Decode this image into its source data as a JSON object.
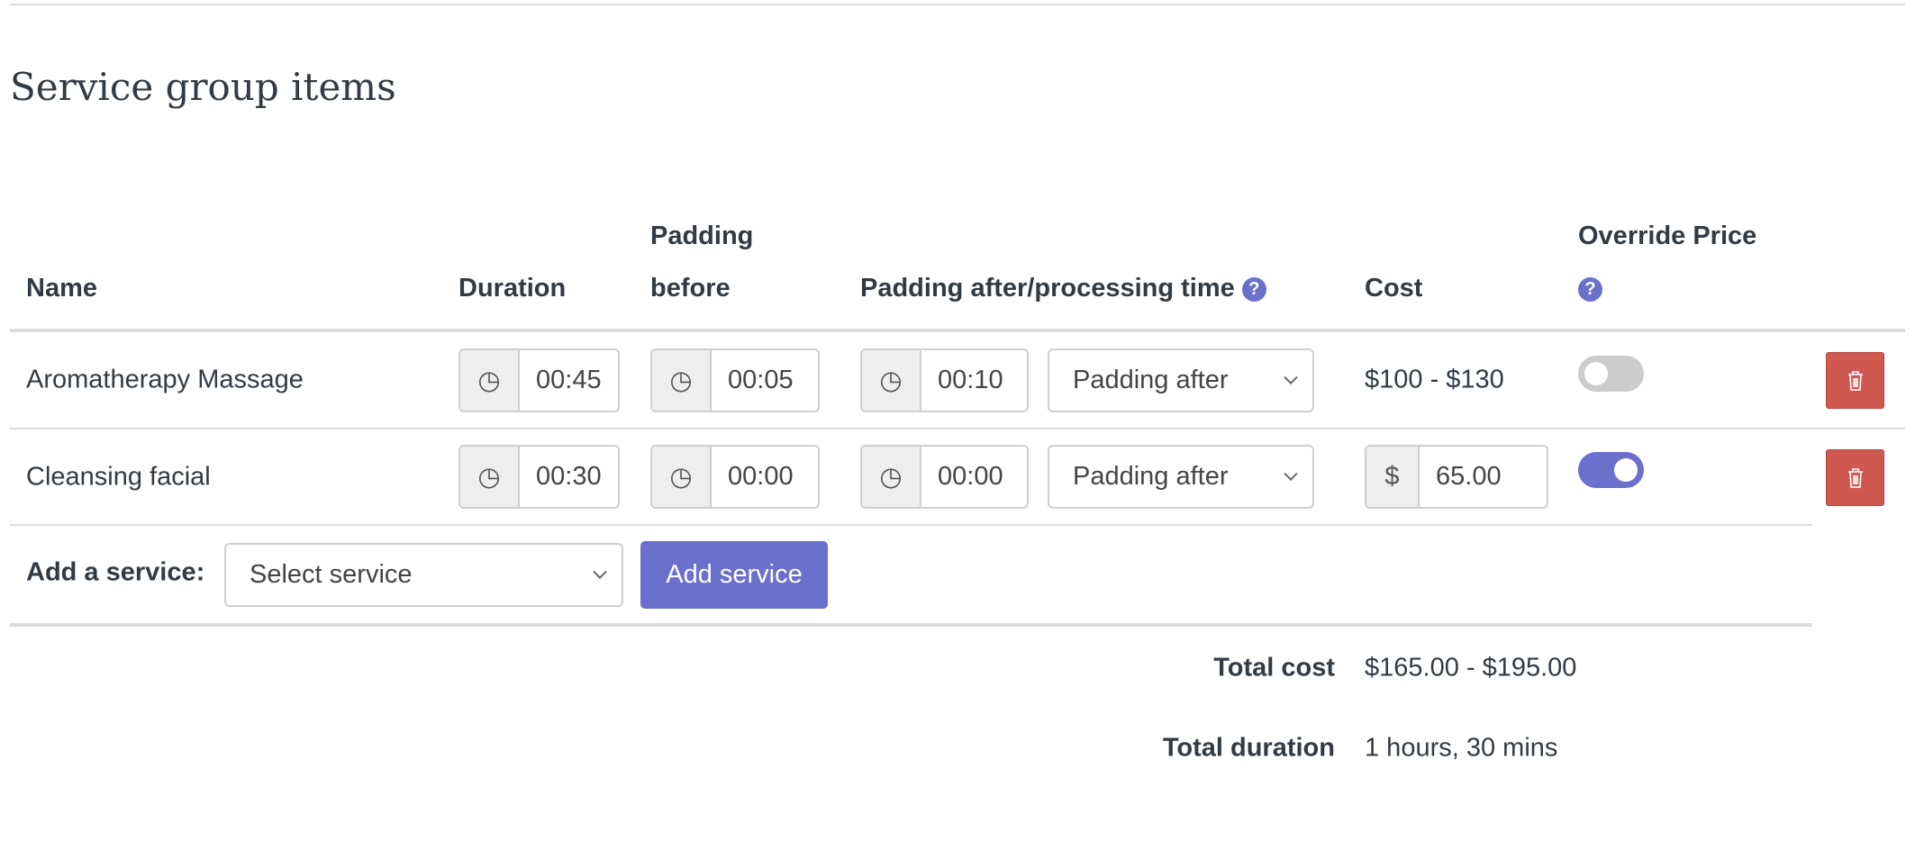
{
  "section_title": "Service group items",
  "columns": {
    "name": "Name",
    "duration": "Duration",
    "padding_before_1": "Padding",
    "padding_before_2": "before",
    "padding_after": "Padding after/processing time",
    "cost": "Cost",
    "override_price": "Override Price"
  },
  "help_icon": "?",
  "rows": [
    {
      "name": "Aromatherapy Massage",
      "duration": "00:45",
      "padding_before": "00:05",
      "padding_after": "00:10",
      "padding_type": "Padding after",
      "cost": "$100 - $130",
      "override": false
    },
    {
      "name": "Cleansing facial",
      "duration": "00:30",
      "padding_before": "00:00",
      "padding_after": "00:00",
      "padding_type": "Padding after",
      "currency": "$",
      "cost_value": "65.00",
      "override": true
    }
  ],
  "add_service": {
    "label": "Add a service:",
    "select_value": "Select service",
    "button": "Add service"
  },
  "totals": {
    "cost_label": "Total cost",
    "cost_value": "$165.00 - $195.00",
    "duration_label": "Total duration",
    "duration_value": "1 hours, 30 mins"
  },
  "colors": {
    "accent": "#6a70cc",
    "danger": "#cf5850",
    "toggle_off": "#cccccc"
  }
}
